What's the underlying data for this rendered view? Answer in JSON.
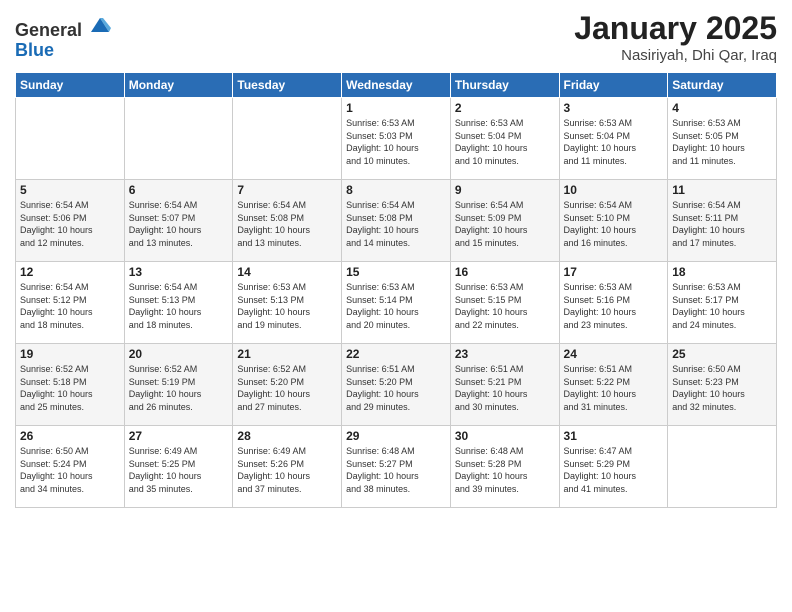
{
  "header": {
    "logo_line1": "General",
    "logo_line2": "Blue",
    "title": "January 2025",
    "location": "Nasiriyah, Dhi Qar, Iraq"
  },
  "weekdays": [
    "Sunday",
    "Monday",
    "Tuesday",
    "Wednesday",
    "Thursday",
    "Friday",
    "Saturday"
  ],
  "weeks": [
    [
      {
        "day": "",
        "info": ""
      },
      {
        "day": "",
        "info": ""
      },
      {
        "day": "",
        "info": ""
      },
      {
        "day": "1",
        "info": "Sunrise: 6:53 AM\nSunset: 5:03 PM\nDaylight: 10 hours\nand 10 minutes."
      },
      {
        "day": "2",
        "info": "Sunrise: 6:53 AM\nSunset: 5:04 PM\nDaylight: 10 hours\nand 10 minutes."
      },
      {
        "day": "3",
        "info": "Sunrise: 6:53 AM\nSunset: 5:04 PM\nDaylight: 10 hours\nand 11 minutes."
      },
      {
        "day": "4",
        "info": "Sunrise: 6:53 AM\nSunset: 5:05 PM\nDaylight: 10 hours\nand 11 minutes."
      }
    ],
    [
      {
        "day": "5",
        "info": "Sunrise: 6:54 AM\nSunset: 5:06 PM\nDaylight: 10 hours\nand 12 minutes."
      },
      {
        "day": "6",
        "info": "Sunrise: 6:54 AM\nSunset: 5:07 PM\nDaylight: 10 hours\nand 13 minutes."
      },
      {
        "day": "7",
        "info": "Sunrise: 6:54 AM\nSunset: 5:08 PM\nDaylight: 10 hours\nand 13 minutes."
      },
      {
        "day": "8",
        "info": "Sunrise: 6:54 AM\nSunset: 5:08 PM\nDaylight: 10 hours\nand 14 minutes."
      },
      {
        "day": "9",
        "info": "Sunrise: 6:54 AM\nSunset: 5:09 PM\nDaylight: 10 hours\nand 15 minutes."
      },
      {
        "day": "10",
        "info": "Sunrise: 6:54 AM\nSunset: 5:10 PM\nDaylight: 10 hours\nand 16 minutes."
      },
      {
        "day": "11",
        "info": "Sunrise: 6:54 AM\nSunset: 5:11 PM\nDaylight: 10 hours\nand 17 minutes."
      }
    ],
    [
      {
        "day": "12",
        "info": "Sunrise: 6:54 AM\nSunset: 5:12 PM\nDaylight: 10 hours\nand 18 minutes."
      },
      {
        "day": "13",
        "info": "Sunrise: 6:54 AM\nSunset: 5:13 PM\nDaylight: 10 hours\nand 18 minutes."
      },
      {
        "day": "14",
        "info": "Sunrise: 6:53 AM\nSunset: 5:13 PM\nDaylight: 10 hours\nand 19 minutes."
      },
      {
        "day": "15",
        "info": "Sunrise: 6:53 AM\nSunset: 5:14 PM\nDaylight: 10 hours\nand 20 minutes."
      },
      {
        "day": "16",
        "info": "Sunrise: 6:53 AM\nSunset: 5:15 PM\nDaylight: 10 hours\nand 22 minutes."
      },
      {
        "day": "17",
        "info": "Sunrise: 6:53 AM\nSunset: 5:16 PM\nDaylight: 10 hours\nand 23 minutes."
      },
      {
        "day": "18",
        "info": "Sunrise: 6:53 AM\nSunset: 5:17 PM\nDaylight: 10 hours\nand 24 minutes."
      }
    ],
    [
      {
        "day": "19",
        "info": "Sunrise: 6:52 AM\nSunset: 5:18 PM\nDaylight: 10 hours\nand 25 minutes."
      },
      {
        "day": "20",
        "info": "Sunrise: 6:52 AM\nSunset: 5:19 PM\nDaylight: 10 hours\nand 26 minutes."
      },
      {
        "day": "21",
        "info": "Sunrise: 6:52 AM\nSunset: 5:20 PM\nDaylight: 10 hours\nand 27 minutes."
      },
      {
        "day": "22",
        "info": "Sunrise: 6:51 AM\nSunset: 5:20 PM\nDaylight: 10 hours\nand 29 minutes."
      },
      {
        "day": "23",
        "info": "Sunrise: 6:51 AM\nSunset: 5:21 PM\nDaylight: 10 hours\nand 30 minutes."
      },
      {
        "day": "24",
        "info": "Sunrise: 6:51 AM\nSunset: 5:22 PM\nDaylight: 10 hours\nand 31 minutes."
      },
      {
        "day": "25",
        "info": "Sunrise: 6:50 AM\nSunset: 5:23 PM\nDaylight: 10 hours\nand 32 minutes."
      }
    ],
    [
      {
        "day": "26",
        "info": "Sunrise: 6:50 AM\nSunset: 5:24 PM\nDaylight: 10 hours\nand 34 minutes."
      },
      {
        "day": "27",
        "info": "Sunrise: 6:49 AM\nSunset: 5:25 PM\nDaylight: 10 hours\nand 35 minutes."
      },
      {
        "day": "28",
        "info": "Sunrise: 6:49 AM\nSunset: 5:26 PM\nDaylight: 10 hours\nand 37 minutes."
      },
      {
        "day": "29",
        "info": "Sunrise: 6:48 AM\nSunset: 5:27 PM\nDaylight: 10 hours\nand 38 minutes."
      },
      {
        "day": "30",
        "info": "Sunrise: 6:48 AM\nSunset: 5:28 PM\nDaylight: 10 hours\nand 39 minutes."
      },
      {
        "day": "31",
        "info": "Sunrise: 6:47 AM\nSunset: 5:29 PM\nDaylight: 10 hours\nand 41 minutes."
      },
      {
        "day": "",
        "info": ""
      }
    ]
  ]
}
